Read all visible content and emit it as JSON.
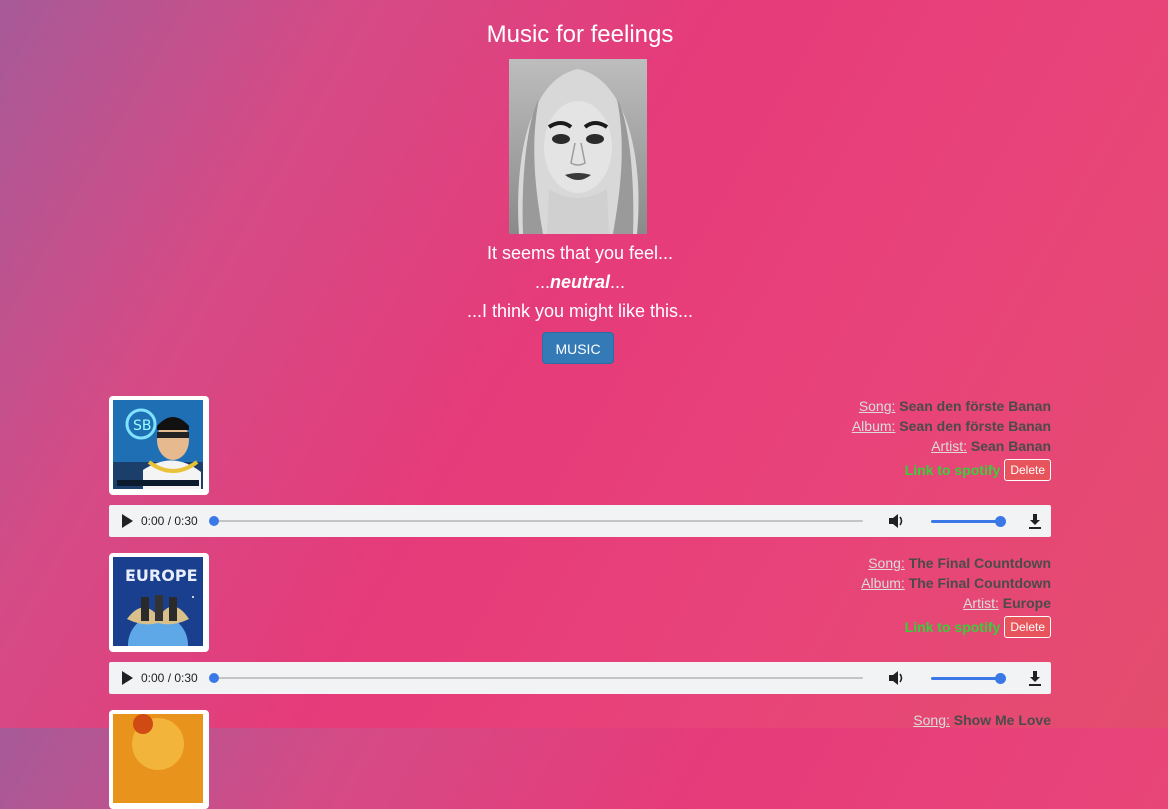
{
  "page": {
    "title": "Music for feelings",
    "feel_prefix": "It seems that you feel...",
    "emotion_before": "...",
    "emotion": "neutral",
    "emotion_after": "...",
    "suggestion": "...I think you might like this...",
    "music_button": "MUSIC"
  },
  "labels": {
    "song": "Song:",
    "album": "Album:",
    "artist": "Artist:",
    "spotify": "Link to spotify",
    "delete": "Delete"
  },
  "tracks": [
    {
      "song": "Sean den förste Banan",
      "album": "Sean den förste Banan",
      "artist": "Sean Banan",
      "cover_icon": "album-cover-sean-banan",
      "player": {
        "time": "0:00",
        "duration": "0:30",
        "progress": 0,
        "volume": 1.0
      }
    },
    {
      "song": "The Final Countdown",
      "album": "The Final Countdown",
      "artist": "Europe",
      "cover_icon": "album-cover-europe",
      "player": {
        "time": "0:00",
        "duration": "0:30",
        "progress": 0,
        "volume": 1.0
      }
    },
    {
      "song": "Show Me Love",
      "cover_icon": "album-cover-show-me-love"
    }
  ],
  "colors": {
    "accent_button": "#337ab7",
    "spotify_link": "#36d03a",
    "delete_button": "#e8545b",
    "player_accent": "#3b78e7"
  }
}
